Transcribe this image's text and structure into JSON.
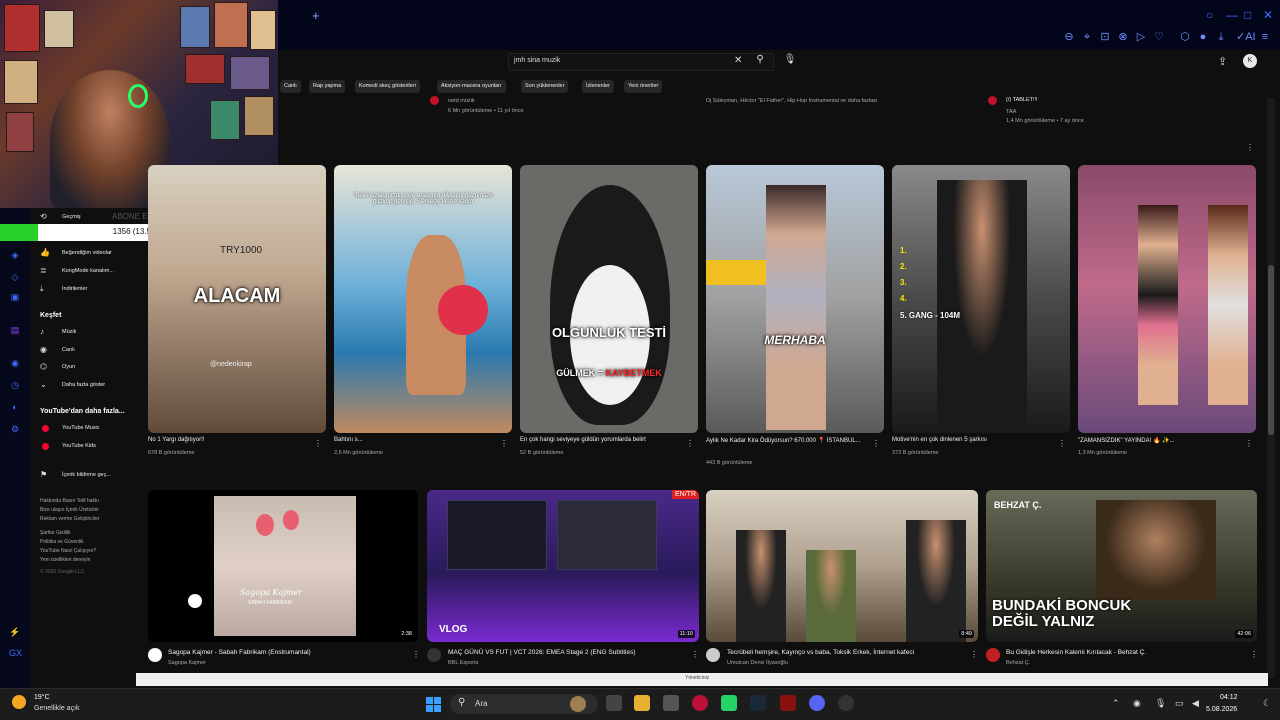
{
  "search": {
    "query": "jmh sina muzik"
  },
  "chips": [
    "Canlı",
    "Rap yapma",
    "Komedi skeç gösterileri",
    "Aksiyon-macera oyunları",
    "Son yüklenenler",
    "İzlenenler",
    "Yeni öneriler"
  ],
  "top_row": [
    {
      "channel": "netd müzik",
      "meta": "6 Mn görüntüleme • 11 yıl önce"
    },
    {
      "channel": "Dj Süleyman, Héctor \"El Father\", Hip Hop Instrumental ve daha fazlası"
    },
    {
      "title": "(/) TABLET!!!",
      "channel": "TAA",
      "meta": "1,4 Mn görüntüleme • 7 ay önce"
    }
  ],
  "webcam": {
    "label": "ABONE EKLİ",
    "counter": "1356 (13.50%)",
    "progress": 0.135,
    "try": "TRY1000"
  },
  "sidebar": {
    "items": [
      {
        "icon": "history-icon",
        "label": "Geçmiş"
      },
      {
        "icon": "like-icon",
        "label": "Beğendiğim videolar"
      },
      {
        "icon": "playlist-icon",
        "label": "KongMode kanalım..."
      },
      {
        "icon": "download-icon",
        "label": "İndirilenler"
      }
    ],
    "explore_heading": "Keşfet",
    "explore": [
      {
        "icon": "music-icon",
        "label": "Müzik"
      },
      {
        "icon": "live-icon",
        "label": "Canlı"
      },
      {
        "icon": "gaming-icon",
        "label": "Oyun"
      },
      {
        "icon": "chevron-down-icon",
        "label": "Daha fazla göster"
      }
    ],
    "more_heading": "YouTube'dan daha fazla...",
    "more": [
      {
        "icon": "youtube-music-icon",
        "label": "YouTube Music"
      },
      {
        "icon": "youtube-kids-icon",
        "label": "YouTube Kids"
      }
    ],
    "feedback": "İçerik bildirme geç...",
    "footer": [
      "Hakkında  Basın  Telif hakkı",
      "Bize ulaşın  İçerik Üreticiler",
      "Reklam verme  Geliştiriciler",
      "",
      "Şartlar  Gizlilik",
      "Politika ve Güvenlik",
      "YouTube Nasıl Çalışıyor?",
      "Yeni özellikleri deneyin",
      "",
      "© 2026 Google LLC"
    ]
  },
  "shorts": [
    {
      "title": "No 1 Yargı dağıtıyor!!",
      "views": "678 B görüntüleme",
      "overlay": "ALACAM",
      "watermark": "@nedenkirap"
    },
    {
      "title": "Bahtını s...",
      "views": "2,6 Mn görüntüleme",
      "overlay": "\"Belki kızlarımızdır diye anasının dikkatini ğüzümüze ğüzkop getirsip. 5 erkeğe veren kadın"
    },
    {
      "title": "En çok hangi seviyeye güldün yorumlarda belirt",
      "views": "52 B görüntüleme",
      "overlay": "OLGUNLUK TESTİ",
      "overlay2a": "GÜLMEK = ",
      "overlay2b": "KAYBETMEK"
    },
    {
      "title": "Aylık Ne Kadar Kira Ödüyorsun? 670.000 📍 İSTANBUL...",
      "views": "443 B görüntüleme",
      "overlay": "MERHABA"
    },
    {
      "title": "Motive'nin en çok dinlenen 5 şarkısı",
      "views": "373 B görüntüleme",
      "overlay": "5. GANG - 104M",
      "nums": "1.\n2.\n3.\n4."
    },
    {
      "title": "\"ZAMANSIZDIK\" YAYINDA! 🔥 ✨...",
      "views": "1,3 Mn görüntüleme"
    }
  ],
  "videos": [
    {
      "title": "Sagopa Kajmer - Sabah Fabrikam (Enstrumantal)",
      "channel": "Sagopa Kajmer",
      "duration": "2:38",
      "meta": "3,2 Mn görüntüleme • 11 yıl önce",
      "poster": "Sagopa Kajmer",
      "poster_sub": "SABAH FABRİKAM"
    },
    {
      "title": "MAÇ GÜNÜ VS FUT | VCT 2026: EMEA Stage 2 (ENG Subtitles)",
      "channel": "BBL Esports",
      "duration": "11:10",
      "tag": "EN/TR",
      "overlay": "VLOG",
      "meta": "30 B görüntüleme • 2 gün önce"
    },
    {
      "title": "Tecrübeli hemşire, Kayınço vs baba, Toksik Erkek, İnternet kafeci",
      "channel": "Umutcan Deniz İlyasoğlu",
      "duration": "8:49",
      "meta": "446 B görüntüleme • 2 yıl önce"
    },
    {
      "title": "Bu Gidişle Herkesin Kalemi Kırılacak - Behzat Ç.",
      "channel": "Behzat Ç.",
      "duration": "42:06",
      "overlay": "BUNDAKİ BONCUK\nDEĞİL YALNIZ",
      "tag": "BEHZAT Ç.",
      "meta": "21 B görüntüleme • 3 yıl önce"
    }
  ],
  "statusbar": "Yöneticiniz",
  "taskbar": {
    "temp": "19°C",
    "weather": "Genellikle açık",
    "search": "Ara",
    "time": "04:12",
    "date": "5.08.2026"
  }
}
